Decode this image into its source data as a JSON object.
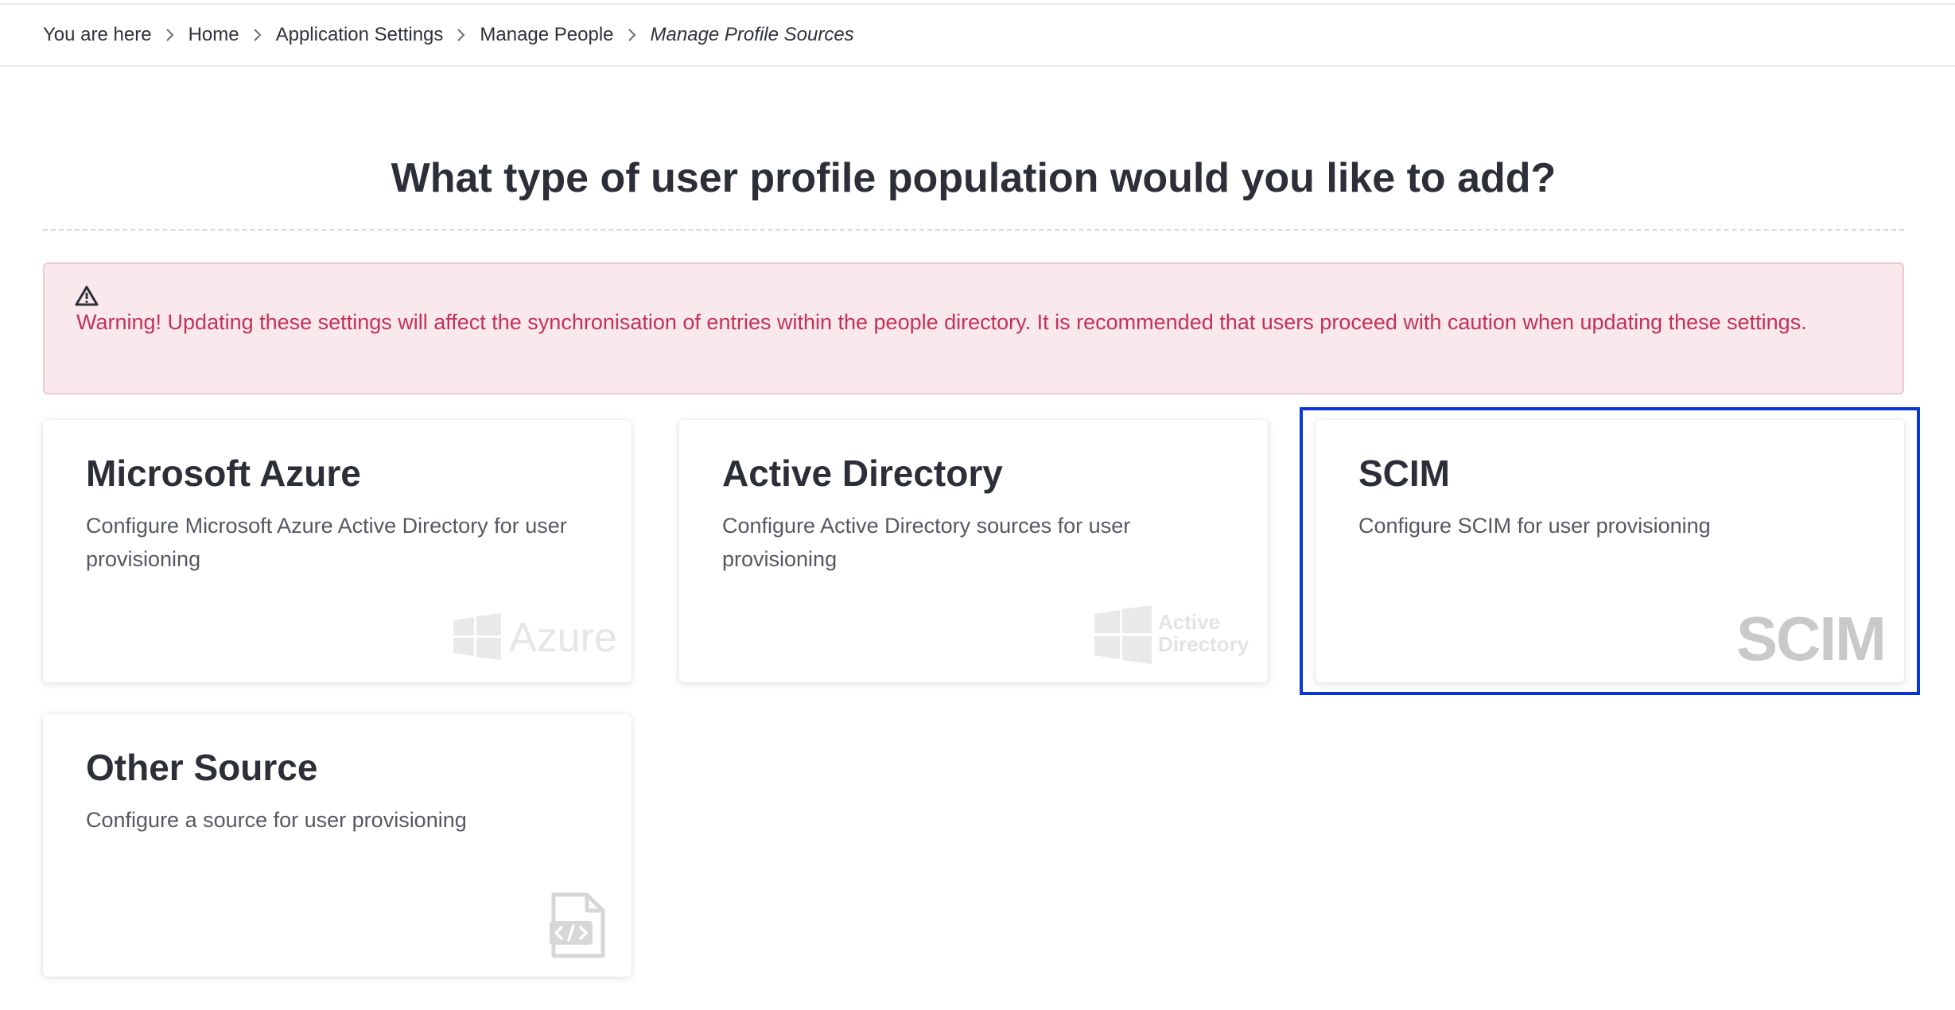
{
  "breadcrumb": {
    "items": [
      {
        "label": "You are here"
      },
      {
        "label": "Home"
      },
      {
        "label": "Application Settings"
      },
      {
        "label": "Manage People"
      },
      {
        "label": "Manage Profile Sources"
      }
    ]
  },
  "page": {
    "title": "What type of user profile population would you like to add?"
  },
  "warning": {
    "icon": "warning-triangle-icon",
    "text": "Warning! Updating these settings will affect the synchronisation of entries within the people directory. It is recommended that users proceed with caution when updating these settings."
  },
  "cards": [
    {
      "title": "Microsoft Azure",
      "description": "Configure Microsoft Azure Active Directory for user provisioning",
      "logo_icon": "azure-logo-icon",
      "logo_text": "Azure"
    },
    {
      "title": "Active Directory",
      "description": "Configure Active Directory sources for user provisioning",
      "logo_icon": "active-directory-logo-icon",
      "logo_text_line1": "Active",
      "logo_text_line2": "Directory"
    },
    {
      "title": "SCIM",
      "description": "Configure SCIM for user provisioning",
      "logo_icon": "scim-logo-icon",
      "logo_text": "SCIM"
    },
    {
      "title": "Other Source",
      "description": "Configure a source for user provisioning",
      "logo_icon": "code-file-icon"
    }
  ],
  "colors": {
    "warning_text": "#c2325a",
    "warning_bg": "#f9e8ec",
    "highlight_border": "#0a35d8"
  }
}
